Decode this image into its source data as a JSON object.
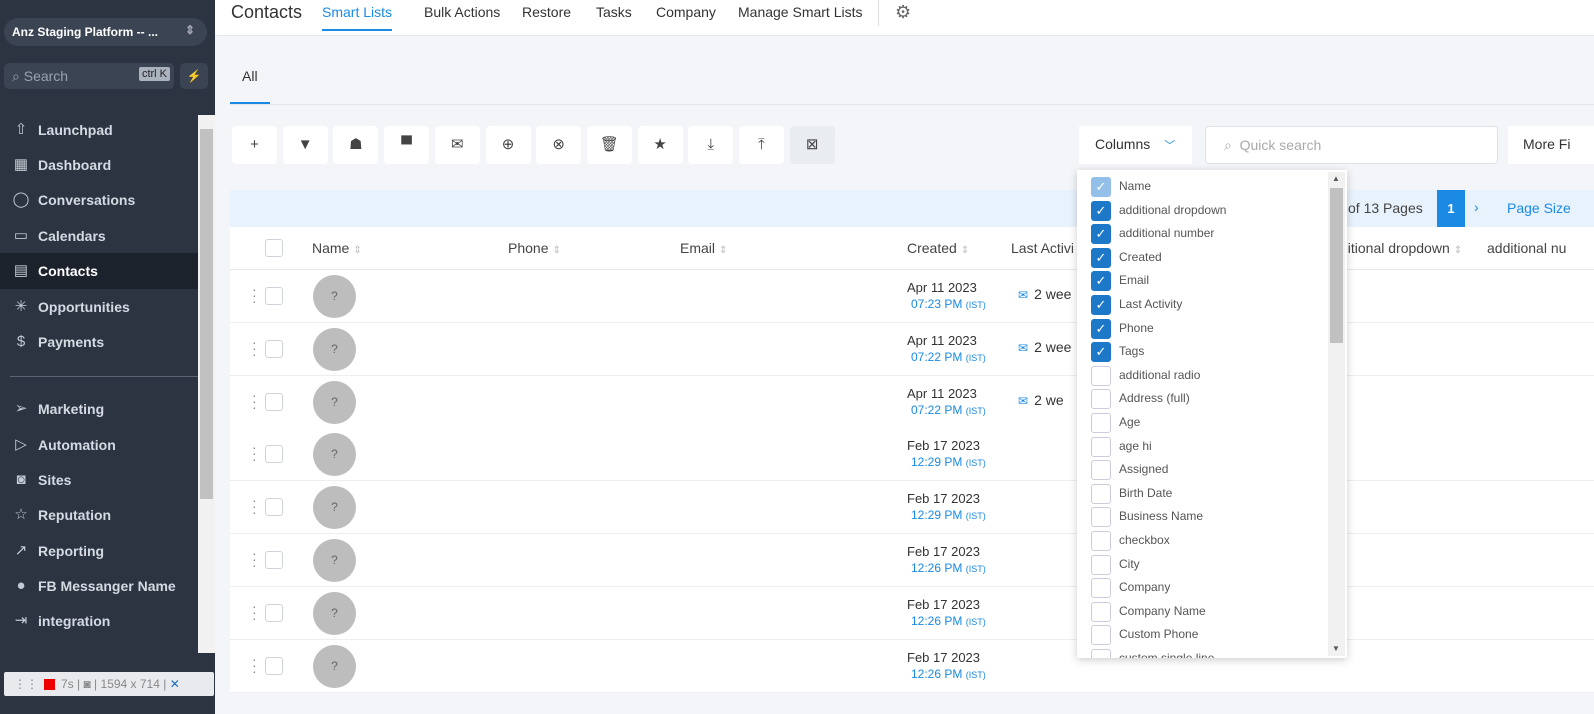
{
  "sidebar": {
    "org": "Anz Staging Platform -- ...",
    "search_placeholder": "Search",
    "search_shortcut": "ctrl K",
    "items": [
      {
        "label": "Launchpad",
        "icon": "launchpad-icon",
        "glyph": "⇧"
      },
      {
        "label": "Dashboard",
        "icon": "dashboard-icon",
        "glyph": "▦"
      },
      {
        "label": "Conversations",
        "icon": "chat-icon",
        "glyph": "◯"
      },
      {
        "label": "Calendars",
        "icon": "calendar-icon",
        "glyph": "▭"
      },
      {
        "label": "Contacts",
        "icon": "contacts-icon",
        "glyph": "▤",
        "active": true
      },
      {
        "label": "Opportunities",
        "icon": "opportunities-icon",
        "glyph": "✳"
      },
      {
        "label": "Payments",
        "icon": "payments-icon",
        "glyph": "$"
      },
      {
        "label": "Marketing",
        "icon": "send-icon",
        "glyph": "➢"
      },
      {
        "label": "Automation",
        "icon": "automation-icon",
        "glyph": "▷"
      },
      {
        "label": "Sites",
        "icon": "sites-icon",
        "glyph": "◙"
      },
      {
        "label": "Reputation",
        "icon": "star-icon",
        "glyph": "☆"
      },
      {
        "label": "Reporting",
        "icon": "trend-icon",
        "glyph": "↗"
      },
      {
        "label": "FB Messanger Name",
        "icon": "messenger-icon",
        "glyph": "●"
      },
      {
        "label": "integration",
        "icon": "integration-icon",
        "glyph": "⇥"
      }
    ]
  },
  "recorder": {
    "time": "7s",
    "size": "1594 x 714"
  },
  "topbar": {
    "title": "Contacts",
    "tabs": [
      "Smart Lists",
      "Bulk Actions",
      "Restore",
      "Tasks",
      "Company",
      "Manage Smart Lists"
    ]
  },
  "subtab": "All",
  "toolbar": [
    {
      "name": "add",
      "glyph": "+"
    },
    {
      "name": "filter",
      "glyph": "▼"
    },
    {
      "name": "robot",
      "glyph": "☗"
    },
    {
      "name": "sms",
      "glyph": "▀"
    },
    {
      "name": "email",
      "glyph": "✉"
    },
    {
      "name": "add-tag",
      "glyph": "⊕"
    },
    {
      "name": "remove-tag",
      "glyph": "⊗"
    },
    {
      "name": "delete",
      "glyph": "🗑"
    },
    {
      "name": "star",
      "glyph": "★"
    },
    {
      "name": "import",
      "glyph": "⤓"
    },
    {
      "name": "export",
      "glyph": "⤒"
    },
    {
      "name": "merge",
      "glyph": "⊠"
    }
  ],
  "columns_label": "Columns",
  "quick_search_placeholder": "Quick search",
  "more_filters": "More Fi",
  "pagination": {
    "pages_text": "of 13 Pages",
    "current": "1",
    "page_size": "Page Size"
  },
  "table": {
    "headers": [
      "Name",
      "Phone",
      "Email",
      "Created",
      "Last Activi",
      "ditional dropdown",
      "additional nu"
    ],
    "rows": [
      {
        "date": "Apr 11 2023",
        "time": "07:23 PM",
        "tz": "(IST)",
        "activity": "2 wee"
      },
      {
        "date": "Apr 11 2023",
        "time": "07:22 PM",
        "tz": "(IST)",
        "activity": "2 wee"
      },
      {
        "date": "Apr 11 2023",
        "time": "07:22 PM",
        "tz": "(IST)",
        "activity": "2 we"
      },
      {
        "date": "Feb 17 2023",
        "time": "12:29 PM",
        "tz": "(IST)",
        "activity": ""
      },
      {
        "date": "Feb 17 2023",
        "time": "12:29 PM",
        "tz": "(IST)",
        "activity": ""
      },
      {
        "date": "Feb 17 2023",
        "time": "12:26 PM",
        "tz": "(IST)",
        "activity": ""
      },
      {
        "date": "Feb 17 2023",
        "time": "12:26 PM",
        "tz": "(IST)",
        "activity": ""
      },
      {
        "date": "Feb 17 2023",
        "time": "12:26 PM",
        "tz": "(IST)",
        "activity": ""
      }
    ],
    "avatar": "?"
  },
  "column_options": [
    {
      "label": "Name",
      "checked": true,
      "disabled": true
    },
    {
      "label": "additional dropdown",
      "checked": true
    },
    {
      "label": "additional number",
      "checked": true
    },
    {
      "label": "Created",
      "checked": true
    },
    {
      "label": "Email",
      "checked": true
    },
    {
      "label": "Last Activity",
      "checked": true
    },
    {
      "label": "Phone",
      "checked": true
    },
    {
      "label": "Tags",
      "checked": true
    },
    {
      "label": "additional radio",
      "checked": false
    },
    {
      "label": "Address (full)",
      "checked": false
    },
    {
      "label": "Age",
      "checked": false
    },
    {
      "label": "age hi",
      "checked": false
    },
    {
      "label": "Assigned",
      "checked": false
    },
    {
      "label": "Birth Date",
      "checked": false
    },
    {
      "label": "Business Name",
      "checked": false
    },
    {
      "label": "checkbox",
      "checked": false
    },
    {
      "label": "City",
      "checked": false
    },
    {
      "label": "Company",
      "checked": false
    },
    {
      "label": "Company Name",
      "checked": false
    },
    {
      "label": "Custom Phone",
      "checked": false
    },
    {
      "label": "custom single line",
      "checked": false
    }
  ]
}
